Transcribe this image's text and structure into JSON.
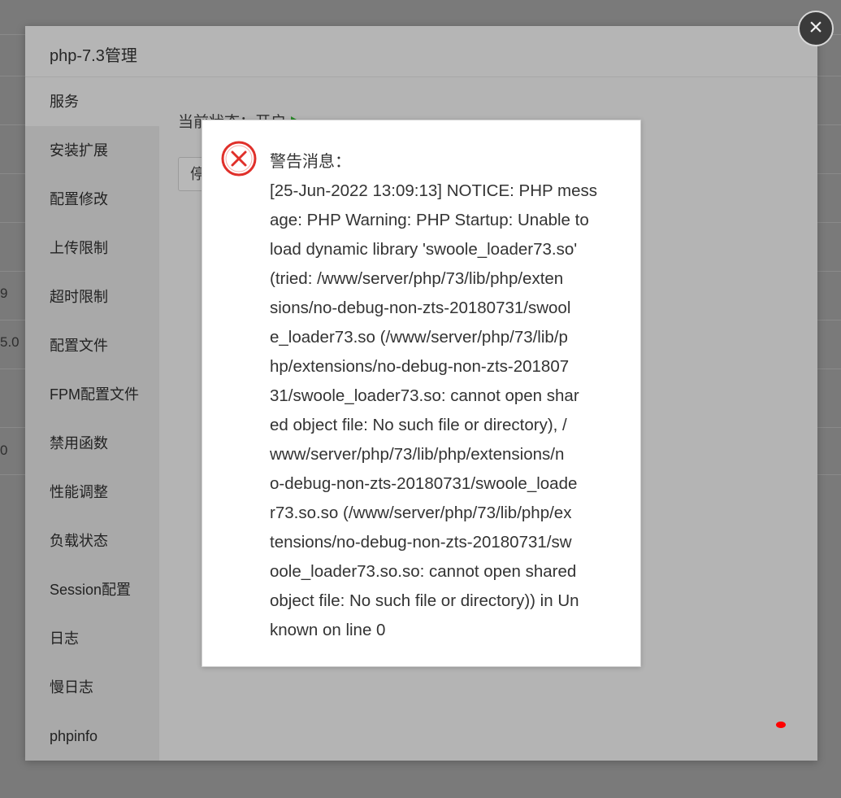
{
  "background_fragments": [
    "9",
    "5.0",
    "0"
  ],
  "modal": {
    "title": "php-7.3管理",
    "sidebar_items": [
      "服务",
      "安装扩展",
      "配置修改",
      "上传限制",
      "超时限制",
      "配置文件",
      "FPM配置文件",
      "禁用函数",
      "性能调整",
      "负载状态",
      "Session配置",
      "日志",
      "慢日志",
      "phpinfo"
    ],
    "active_item_index": 0,
    "status_label": "当前状态：开启",
    "stop_button_label": "停",
    "close_icon": "close-circle-icon"
  },
  "alert": {
    "icon": "error-circle-x-icon",
    "title": "警告消息：",
    "message": "[25-Jun-2022 13:09:13] NOTICE: PHP mess\nage: PHP Warning: PHP Startup: Unable to\nload dynamic library 'swoole_loader73.so'\n(tried: /www/server/php/73/lib/php/exten\nsions/no-debug-non-zts-20180731/swool\ne_loader73.so (/www/server/php/73/lib/p\nhp/extensions/no-debug-non-zts-201807\n31/swoole_loader73.so: cannot open shar\ned object file: No such file or directory), /\nwww/server/php/73/lib/php/extensions/n\no-debug-non-zts-20180731/swoole_loade\nr73.so.so (/www/server/php/73/lib/php/ex\ntensions/no-debug-non-zts-20180731/sw\noole_loader73.so.so: cannot open shared\nobject file: No such file or directory)) in Un\nknown on line 0"
  },
  "colors": {
    "overlay": "#7a7a7a",
    "modal_bg": "#b4b4b4",
    "sidebar_bg": "#a9a9a9",
    "status_green": "#2a8a2a",
    "error_red": "#e0302a",
    "marker_red": "#ff0000"
  }
}
